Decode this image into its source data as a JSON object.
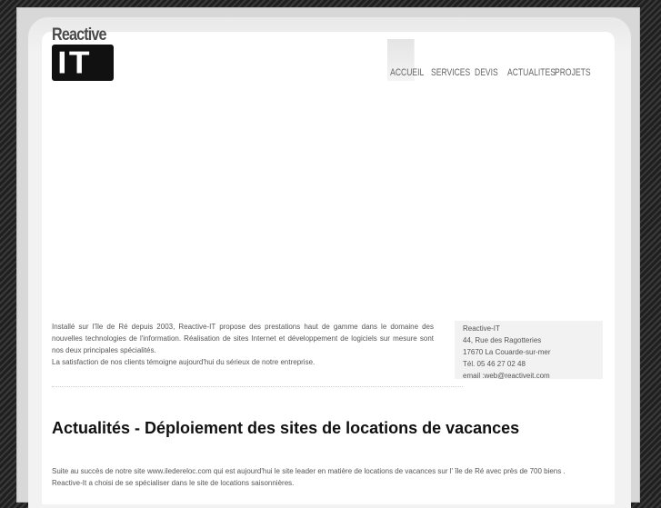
{
  "brand": {
    "word": "Reactive",
    "mark": "IT"
  },
  "nav": [
    {
      "label": "ACCUEIL",
      "active": true
    },
    {
      "label": "SERVICES",
      "active": false
    },
    {
      "label": "DEVIS",
      "active": false
    },
    {
      "label": "ACTUALITES",
      "active": false
    },
    {
      "label": "PROJETS",
      "active": false
    }
  ],
  "intro": {
    "line1": "Installé sur l'île de Ré depuis 2003, Reactive-IT propose des prestations haut de gamme dans le domaine des nouvelles technologies de l'information. Réalisation de sites Internet et développement de logiciels sur mesure sont nos deux principales spécialités.",
    "line2": "La satisfaction de nos clients témoigne aujourd'hui du sérieux de notre entreprise."
  },
  "address": {
    "company": "Reactive-IT",
    "street": "44, Rue des Ragotteries",
    "city": "17670 La Couarde-sur-mer",
    "phone": "Tél. 05 46 27 02 48",
    "email": "email :web@reactiveit.com"
  },
  "news": {
    "title": "Actualités - Déploiement des sites de locations de vacances",
    "body": "Suite au succès de notre site www.iledereloc.com qui est aujourd'hui le site leader en matière de locations de vacances sur l' île de Ré avec près de 700 biens . Reactive-It a choisi de se spécialiser dans le site de locations saisonnières."
  },
  "colors": {
    "panel": "#e9e9e9",
    "nav_active": "#e4e4e4",
    "text": "#555555"
  }
}
